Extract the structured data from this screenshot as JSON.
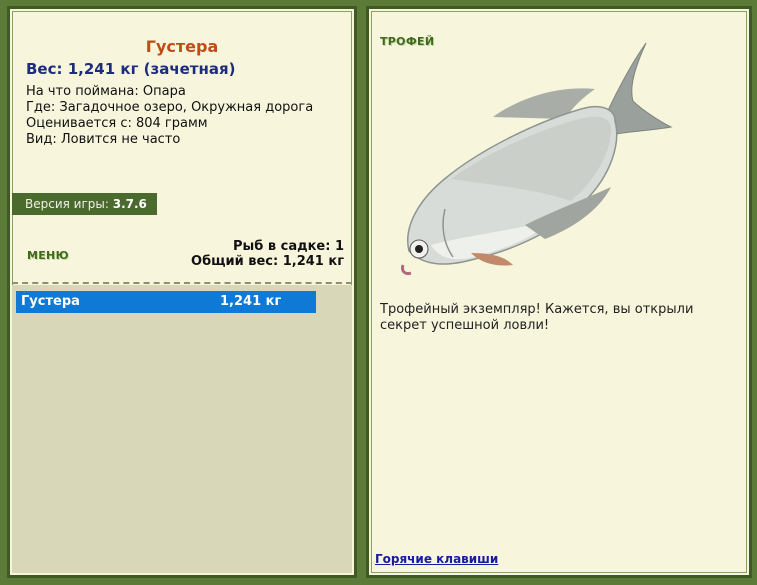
{
  "fish": {
    "name": "Густера",
    "weight_line": "Вес: 1,241 кг (зачетная)",
    "bait": "На что поймана: Опара",
    "location": "Где: Загадочное озеро, Окружная дорога",
    "valued_from": "Оценивается с: 804 грамм",
    "rarity": "Вид: Ловится не часто"
  },
  "version": {
    "label": "Версия игры:",
    "value": "3.7.6"
  },
  "menu": {
    "label": "МЕНЮ"
  },
  "cage": {
    "count_line": "Рыб в садке: 1",
    "total_line": "Общий вес: 1,241 кг",
    "items": [
      {
        "name": "Густера",
        "weight": "1,241 кг"
      }
    ]
  },
  "trophy": {
    "label": "ТРОФЕЙ",
    "text": "Трофейный экземпляр! Кажется, вы открыли секрет успешной ловли!"
  },
  "footer": {
    "hotkeys_link": "Горячие клавиши"
  },
  "icons": {
    "fish_image": "bream-fish-icon"
  },
  "colors": {
    "background": "#5c7a38",
    "panel": "#f7f5dc",
    "fish_name": "#c04c16",
    "weight": "#1e2c7e",
    "selection": "#0e7ad6",
    "version_bar": "#4b6b2e"
  }
}
